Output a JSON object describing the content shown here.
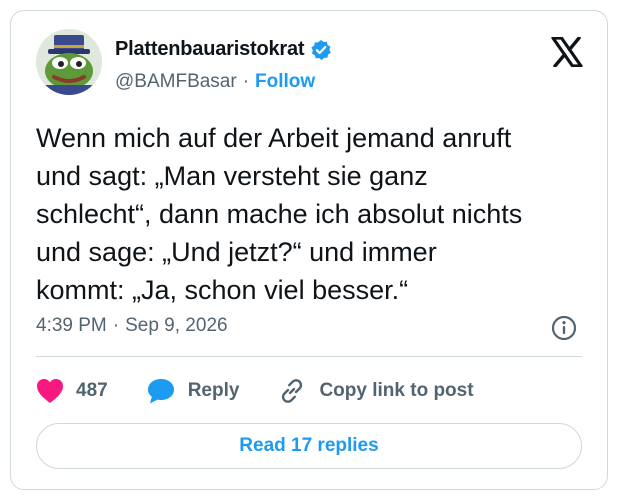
{
  "author": {
    "display_name": "Plattenbauaristokrat",
    "handle": "@BAMFBasar",
    "separator": "·",
    "follow_label": "Follow"
  },
  "tweet": {
    "text": "Wenn mich auf der Arbeit jemand anruft\nund sagt: „Man versteht sie ganz\nschlecht“, dann mache ich absolut nichts\nund sage: „Und jetzt?“ und immer\nkommt: „Ja, schon viel besser.“",
    "time": "4:39 PM",
    "separator": "·",
    "date": "Sep 9, 2026"
  },
  "actions": {
    "like_count": "487",
    "reply_label": "Reply",
    "copy_label": "Copy link to post"
  },
  "read_replies_label": "Read 17 replies",
  "icons": {
    "logo": "x-logo-icon",
    "verified": "verified-badge-icon",
    "info": "info-icon",
    "like": "heart-icon",
    "reply": "speech-bubble-icon",
    "copy": "link-icon"
  },
  "colors": {
    "accent": "#1d9bf0",
    "like": "#f91880",
    "text": "#0f1419",
    "muted": "#536471",
    "border": "#cfd9de"
  }
}
